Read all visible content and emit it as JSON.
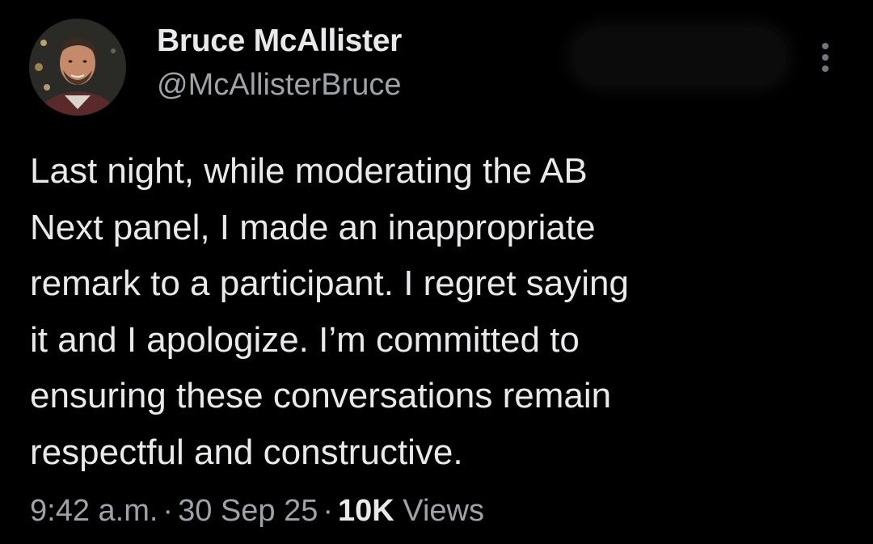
{
  "author": {
    "display_name": "Bruce McAllister",
    "handle": "@McAllisterBruce"
  },
  "tweet": {
    "lines": [
      "Last night, while moderating the AB",
      "Next panel, I made an inappropriate",
      "remark to a participant. I regret saying",
      "it and I apologize. I’m committed to",
      "ensuring these conversations remain",
      "respectful and constructive."
    ]
  },
  "meta": {
    "time": "9:42 a.m.",
    "separator": "·",
    "date": "30 Sep 25",
    "view_count": "10K",
    "views_label": "Views"
  },
  "icons": {
    "more": "more-vertical-icon"
  },
  "colors": {
    "background": "#000000",
    "primary_text": "#e7e9ea",
    "secondary_text": "#9ea3a8"
  }
}
